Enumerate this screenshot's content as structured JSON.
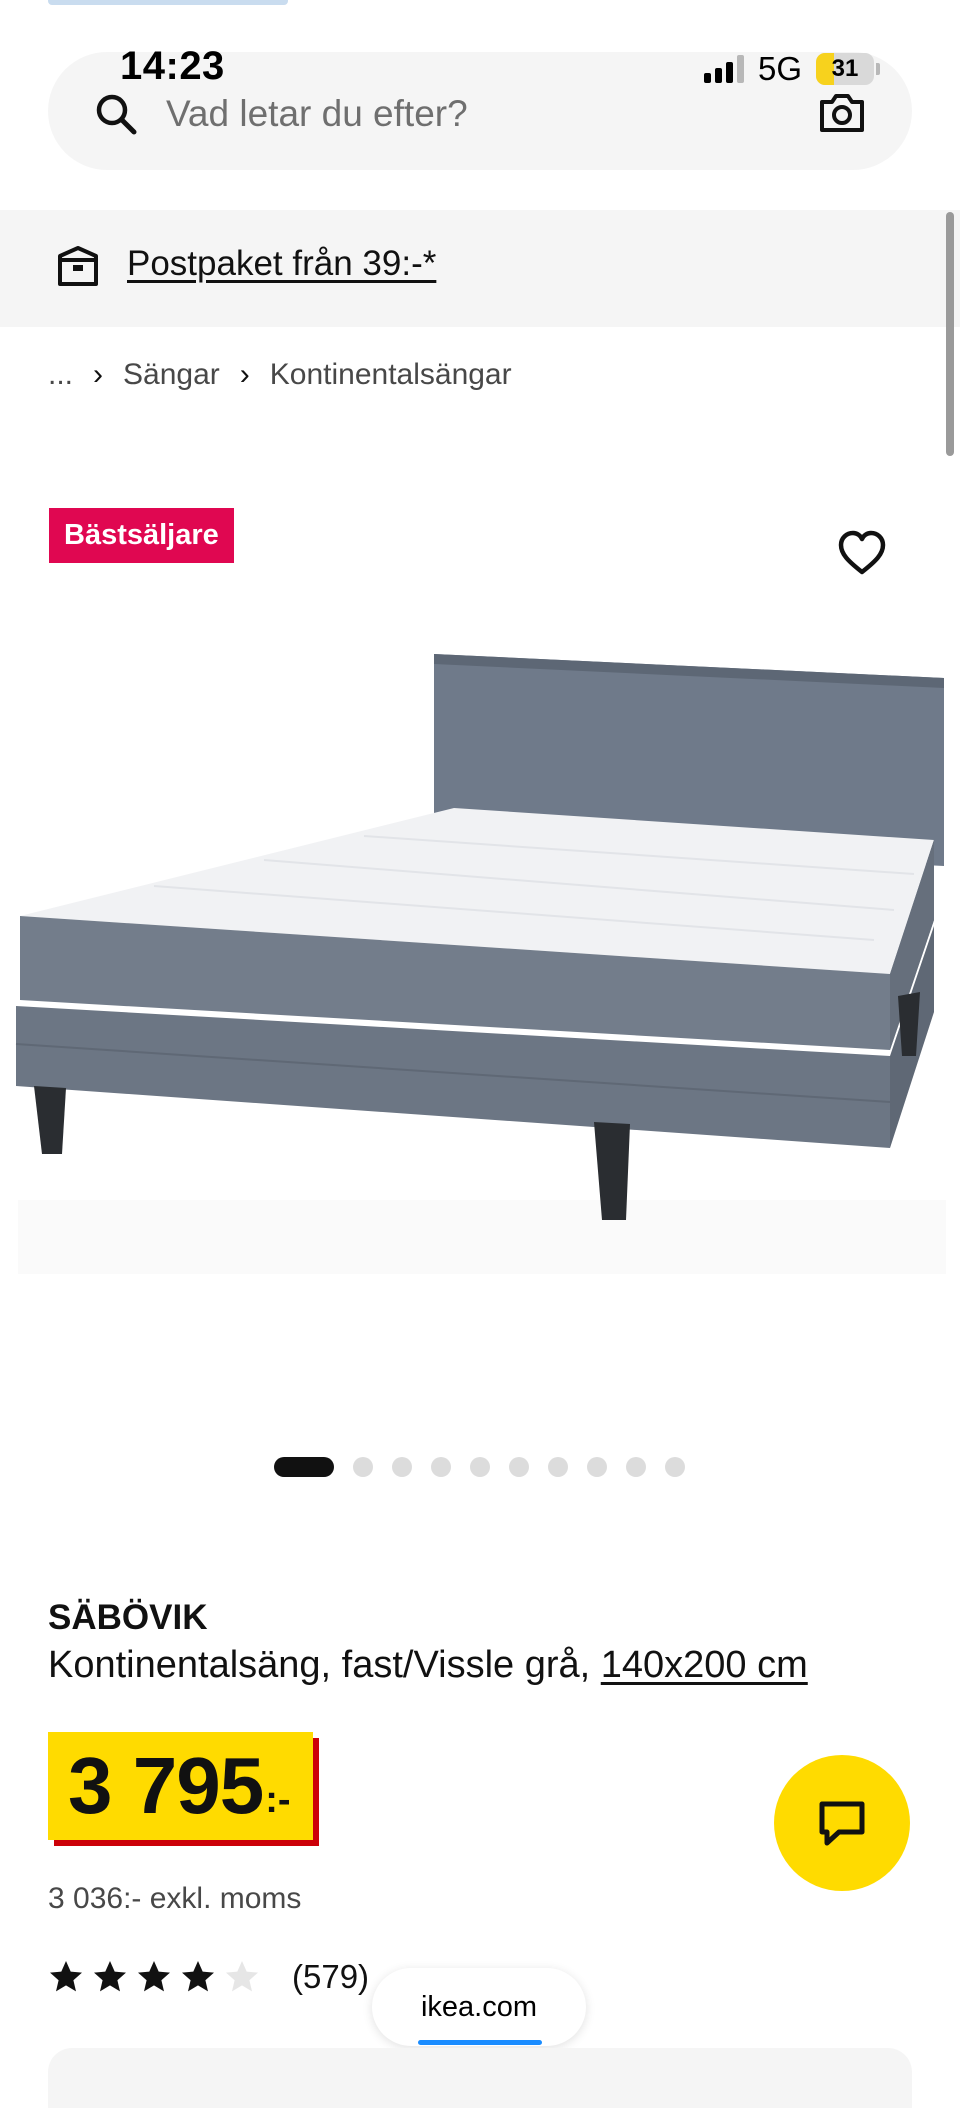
{
  "status_bar": {
    "time": "14:23",
    "network": "5G",
    "battery": "31",
    "battery_level_percent": 31
  },
  "search": {
    "placeholder": "Vad letar du efter?"
  },
  "promo": {
    "link_text": "Postpaket från 39:-*"
  },
  "breadcrumb": {
    "items": [
      "...",
      "Sängar",
      "Kontinentalsängar"
    ]
  },
  "badge": {
    "label": "Bästsäljare",
    "color": "#e00751"
  },
  "gallery": {
    "total_images": 10,
    "active_index": 0
  },
  "product": {
    "name": "SÄBÖVIK",
    "description": "Kontinentalsäng, fast/Vissle grå,",
    "size_link": "140x200 cm",
    "price_integer": "3 795",
    "price_suffix": ":-",
    "price_excl_vat": "3 036:- exkl. moms",
    "rating_stars": 4,
    "rating_max": 5,
    "rating_count": "(579)"
  },
  "browser": {
    "url": "ikea.com"
  },
  "colors": {
    "price_bg": "#ffdb00",
    "price_shadow": "#cc0008",
    "chat_button": "#ffdb00"
  },
  "icons": [
    "search-icon",
    "camera-icon",
    "parcel-icon",
    "heart-icon",
    "chevron-right-icon",
    "chat-icon",
    "star-icon"
  ]
}
